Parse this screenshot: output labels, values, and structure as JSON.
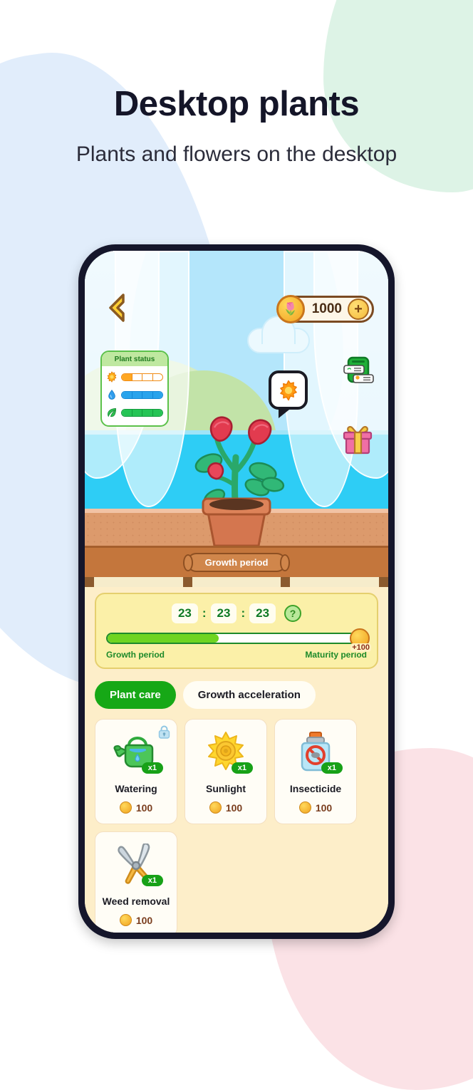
{
  "header": {
    "title": "Desktop plants",
    "subtitle": "Plants and flowers on the desktop"
  },
  "game": {
    "back_icon": "back-chevron-icon",
    "coins": {
      "amount": "1000",
      "add_label": "+",
      "coin_icon": "coin-icon"
    },
    "plant_status": {
      "title": "Plant status",
      "rows": [
        {
          "icon": "sun-icon",
          "filled": 1,
          "total": 4,
          "color": "#ffa722"
        },
        {
          "icon": "water-drop-icon",
          "filled": 4,
          "total": 4,
          "color": "#29a3ec"
        },
        {
          "icon": "leaf-icon",
          "filled": 4,
          "total": 4,
          "color": "#25c455"
        }
      ]
    },
    "bubble_icon": "sun-icon",
    "side_icons": [
      {
        "name": "task-list-icon"
      },
      {
        "name": "gift-icon"
      }
    ],
    "plant_icon": "rose-plant-in-pot",
    "sign_label": "Growth period"
  },
  "growth": {
    "timer": {
      "hours": "23",
      "minutes": "23",
      "seconds": "23",
      "separator": ":"
    },
    "help_label": "?",
    "progress_percent": 43,
    "reward_label": "+100",
    "left_label": "Growth period",
    "right_label": "Maturity period"
  },
  "tabs": [
    {
      "label": "Plant care",
      "active": true
    },
    {
      "label": "Growth acceleration",
      "active": false
    }
  ],
  "items": [
    {
      "name": "Watering",
      "icon": "watering-can-icon",
      "qty": "x1",
      "price": "100",
      "locked": true
    },
    {
      "name": "Sunlight",
      "icon": "sun-icon",
      "qty": "x1",
      "price": "100",
      "locked": false
    },
    {
      "name": "Insecticide",
      "icon": "insecticide-icon",
      "qty": "x1",
      "price": "100",
      "locked": false
    },
    {
      "name": "Weed removal",
      "icon": "pruning-shears-icon",
      "qty": "x1",
      "price": "100",
      "locked": false
    }
  ],
  "colors": {
    "accent_green": "#16a816",
    "coin_gold": "#f0a11e",
    "bezel": "#15162b",
    "panel_cream": "#fdeec9"
  }
}
